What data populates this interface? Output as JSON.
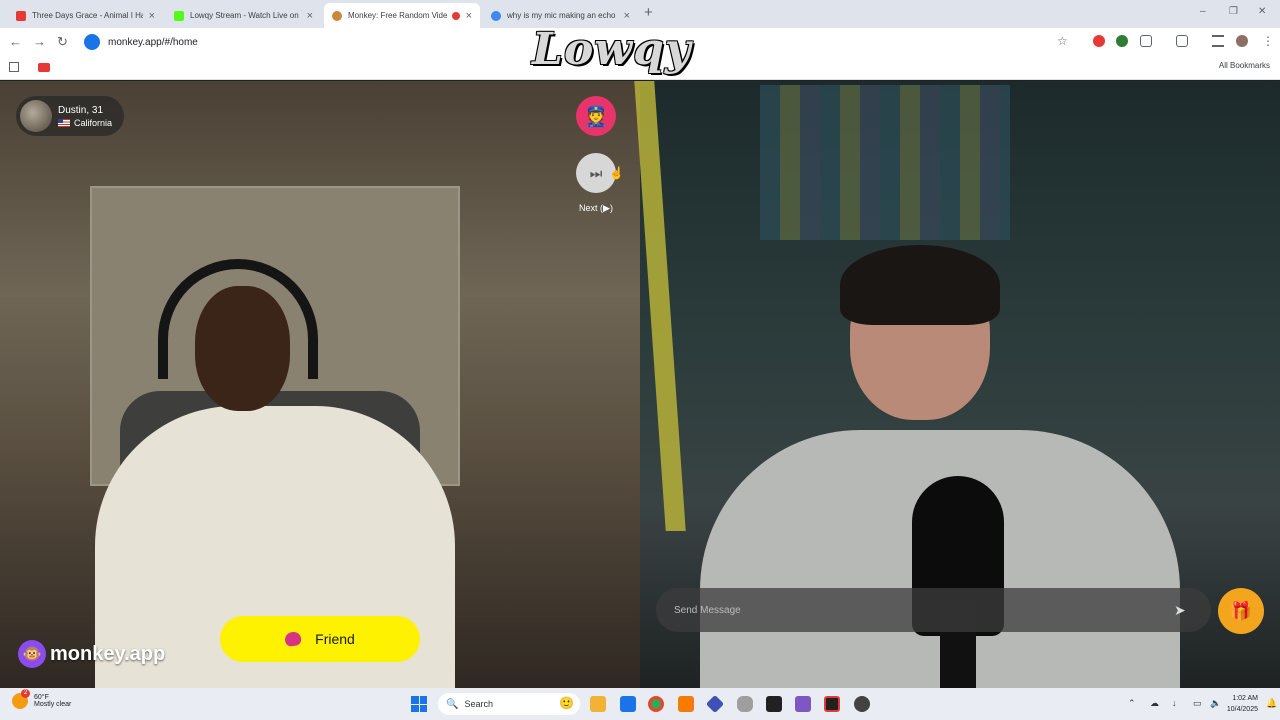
{
  "browser": {
    "tabs": [
      {
        "title": "Three Days Grace - Animal I Ha",
        "active": false,
        "favicon_color": "#e53935"
      },
      {
        "title": "Lowqy Stream - Watch Live on",
        "active": false,
        "favicon_color": "#53fc18"
      },
      {
        "title": "Monkey: Free Random Vide",
        "active": true,
        "favicon_color": "#c7893a"
      },
      {
        "title": "why is my mic making an echo",
        "active": false,
        "favicon_color": "#4285f4"
      }
    ],
    "new_tab": "+",
    "url": "monkey.app/#/home",
    "all_bookmarks": "All Bookmarks"
  },
  "stream_overlay": {
    "logo_text": "Lowqy"
  },
  "call": {
    "remote_user": {
      "name": "Dustin, 31",
      "location": "California"
    },
    "next_label": "Next (▶)",
    "friend_label": "Friend",
    "brand": "monkey.app",
    "message_placeholder": "Send Message",
    "accent_color": "#fff200",
    "report_color": "#e8336b",
    "gift_color": "#f3a51d"
  },
  "taskbar": {
    "weather_temp": "60°F",
    "weather_desc": "Mostly clear",
    "weather_badge": "2",
    "search_label": "Search",
    "time": "1:02 AM",
    "date": "10/4/2025"
  }
}
